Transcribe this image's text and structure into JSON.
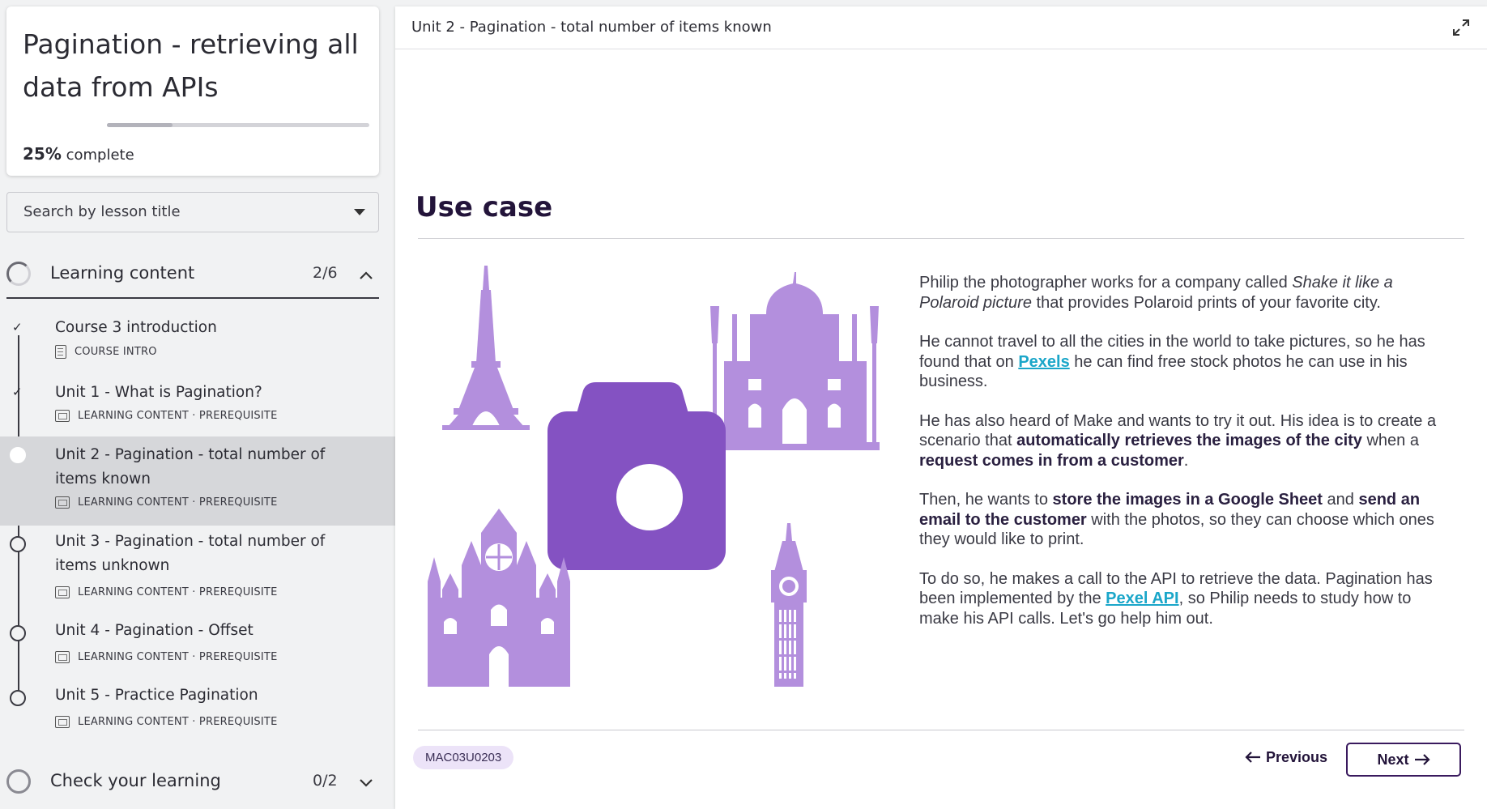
{
  "course": {
    "title": "Pagination - retrieving all data from APIs",
    "progress_percent": "25%",
    "progress_suffix": "complete",
    "progress_fraction": 0.25
  },
  "search": {
    "placeholder": "Search by lesson title"
  },
  "sections": [
    {
      "label": "Learning content",
      "count": "2/6",
      "expanded": true,
      "lessons": [
        {
          "title": "Course 3 introduction",
          "meta": "COURSE INTRO",
          "status": "done",
          "icon": "document-icon"
        },
        {
          "title": "Unit 1 - What is Pagination?",
          "meta": "LEARNING CONTENT · PREREQUISITE",
          "status": "done",
          "icon": "slides-icon"
        },
        {
          "title": "Unit 2 - Pagination - total number of items known",
          "meta": "LEARNING CONTENT · PREREQUISITE",
          "status": "current",
          "icon": "slides-icon"
        },
        {
          "title": "Unit 3 - Pagination - total number of items unknown",
          "meta": "LEARNING CONTENT · PREREQUISITE",
          "status": "open",
          "icon": "slides-icon"
        },
        {
          "title": "Unit 4 - Pagination - Offset",
          "meta": "LEARNING CONTENT · PREREQUISITE",
          "status": "open",
          "icon": "slides-icon"
        },
        {
          "title": "Unit 5 - Practice Pagination",
          "meta": "LEARNING CONTENT · PREREQUISITE",
          "status": "open",
          "icon": "slides-icon"
        }
      ]
    },
    {
      "label": "Check your learning",
      "count": "0/2",
      "expanded": false
    }
  ],
  "main": {
    "breadcrumb": "Unit 2 - Pagination - total number of items known",
    "heading": "Use case",
    "paragraphs": {
      "p1_a": "Philip the photographer works for a company called ",
      "p1_em": "Shake it like a Polaroid picture",
      "p1_b": " that provides Polaroid prints of your favorite city.",
      "p2_a": "He cannot travel to all the cities in the world to take pictures, so he has found that on ",
      "p2_link": "Pexels",
      "p2_b": " he can find free stock photos he can use in his business.",
      "p3_a": "He has also heard of Make and wants to try it out. His idea is to create a scenario that ",
      "p3_b1": "automatically retrieves the images of the city",
      "p3_c": " when a ",
      "p3_b2": "request comes in from a customer",
      "p3_d": ".",
      "p4_a": "Then, he wants to ",
      "p4_b1": "store the images in a Google Sheet",
      "p4_c": " and ",
      "p4_b2": "send an email to the customer",
      "p4_d": " with the photos, so they can choose which ones they would like to print.",
      "p5_a": "To do so, he makes a call to the API to retrieve the data. Pagination has been implemented by the ",
      "p5_link": "Pexel API",
      "p5_b": ", so Philip needs to study how to make his API calls. Let's go help him out."
    },
    "lesson_code": "MAC03U0203",
    "prev_label": "Previous",
    "next_label": "Next"
  },
  "colors": {
    "camera": "#8452c2",
    "landmarks": "#b38fdd",
    "link": "#1aa6c9",
    "heading": "#23143a"
  }
}
